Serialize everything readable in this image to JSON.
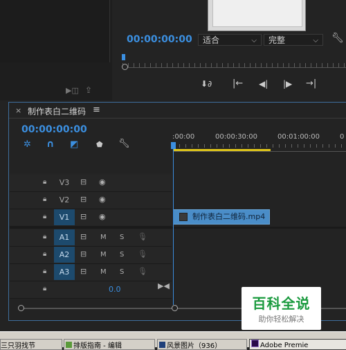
{
  "program_monitor": {
    "timecode": "00:00:00:00",
    "fit_dropdown": "适合",
    "quality_dropdown": "完整",
    "wrench_icon": "wrench-icon",
    "transport": [
      "add-marker-icon",
      "go-to-in-icon",
      "step-back-icon",
      "play-icon",
      "go-to-out-icon"
    ]
  },
  "source_icons": [
    "export-frame-icon",
    "button-editor-icon"
  ],
  "sequence": {
    "close": "×",
    "name": "制作表白二维码",
    "menu": "≡",
    "timecode": "00:00:00:00",
    "ruler": [
      ":00:00",
      "00:00:30:00",
      "00:01:00:00",
      "0"
    ],
    "video_tracks": [
      "V3",
      "V2",
      "V1"
    ],
    "audio_tracks": [
      "A1",
      "A2",
      "A3"
    ],
    "mute": "M",
    "solo": "S",
    "master_value": "0.0",
    "clip_name": "制作表白二维码.mp4"
  },
  "watermark": {
    "title": "百科全说",
    "subtitle": "助你轻松解决"
  },
  "taskbar": {
    "items": [
      "三只羽找节",
      "排版指南 - 编辑",
      "风景图片（936）",
      "Adobe Premie"
    ]
  },
  "colors": {
    "accent": "#3b8fe0",
    "active_track": "#1d4a6d",
    "clip": "#4a8dc8",
    "watermark_green": "#1a9a3e"
  }
}
